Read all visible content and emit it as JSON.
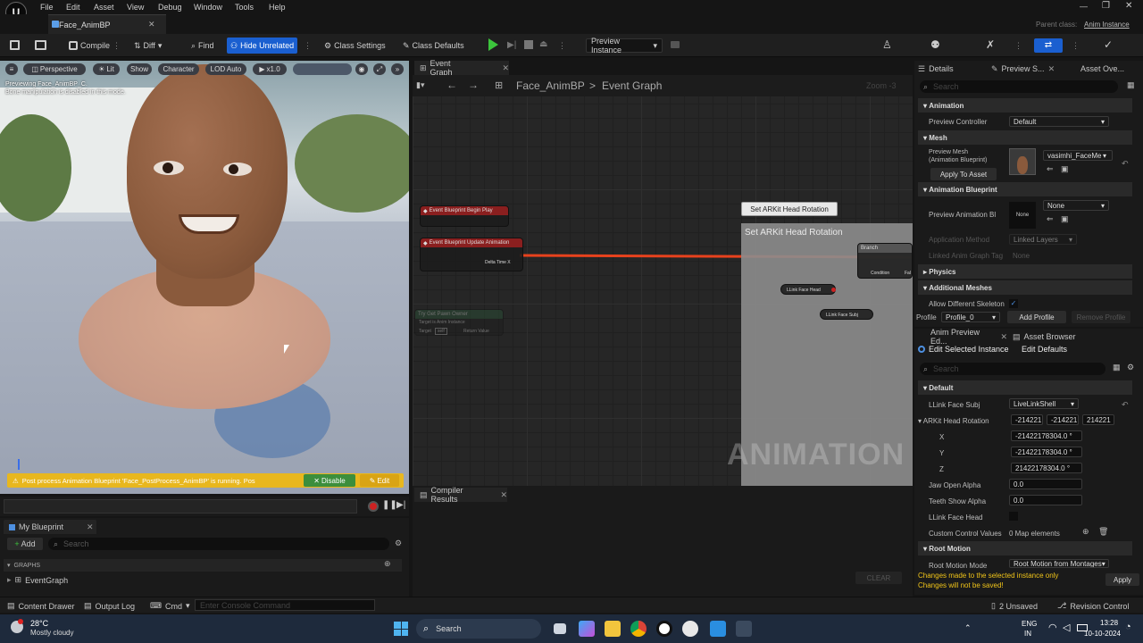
{
  "menu": {
    "items": [
      "File",
      "Edit",
      "Asset",
      "View",
      "Debug",
      "Window",
      "Tools",
      "Help"
    ]
  },
  "window": {
    "tab_title": "Face_AnimBP",
    "parent_class_label": "Parent class:",
    "parent_class_value": "Anim Instance"
  },
  "toolbar": {
    "compile": "Compile",
    "diff": "Diff",
    "find": "Find",
    "hide_unrelated": "Hide Unrelated",
    "class_settings": "Class Settings",
    "class_defaults": "Class Defaults",
    "preview_instance": "Preview Instance"
  },
  "viewport": {
    "perspective": "Perspective",
    "lit": "Lit",
    "show": "Show",
    "character": "Character",
    "lod": "LOD Auto",
    "speed": "x1.0",
    "overlay_line1": "Previewing Face_AnimBP_C.",
    "overlay_line2": "Bone manipulation is disabled in this mode.",
    "notice": "Post process Animation Blueprint 'Face_PostProcess_AnimBP' is running. Pos",
    "disable": "Disable",
    "edit": "Edit"
  },
  "graph": {
    "tab": "Event Graph",
    "breadcrumb_root": "Face_AnimBP",
    "breadcrumb_sep": ">",
    "breadcrumb_leaf": "Event Graph",
    "zoom": "Zoom -3",
    "node_begin_play": "Event Blueprint Begin Play",
    "node_update_anim": "Event Blueprint Update Animation",
    "pin_delta": "Delta Time X",
    "node_comment": "Set ARKit Head Rotation",
    "group_title": "Set ARKit Head Rotation",
    "node_branch": "Branch",
    "pin_condition": "Condition",
    "pin_false": "Fal",
    "node_face_head": "LLink Face Head",
    "node_face_subj": "LLink Face Subj",
    "node_faded_title": "Try Get Pawn Owner",
    "node_faded_sub": "Target is Anim Instance",
    "node_faded_target": "Target",
    "node_faded_self": "self",
    "node_faded_return": "Return Value",
    "watermark": "ANIMATION"
  },
  "compiler": {
    "tab": "Compiler Results",
    "clear": "CLEAR"
  },
  "my_blueprint": {
    "tab": "My Blueprint",
    "add": "Add",
    "search_placeholder": "Search",
    "graphs": "GRAPHS",
    "event_graph": "EventGraph"
  },
  "details": {
    "tab_details": "Details",
    "tab_preview": "Preview S...",
    "tab_asset": "Asset Ove...",
    "search_placeholder": "Search",
    "sec_animation": "Animation",
    "preview_controller": "Preview Controller",
    "preview_controller_val": "Default",
    "sec_mesh": "Mesh",
    "preview_mesh": "Preview Mesh",
    "preview_mesh_sub": "(Animation Blueprint)",
    "mesh_val": "vasimhi_FaceMe",
    "apply_to_asset": "Apply To Asset",
    "sec_anim_bp": "Animation Blueprint",
    "preview_anim_bp": "Preview Animation Bl",
    "none": "None",
    "none2": "None",
    "app_method": "Application Method",
    "app_method_val": "Linked Layers",
    "linked_tag": "Linked Anim Graph Tag",
    "linked_tag_val": "None",
    "sec_physics": "Physics",
    "sec_additional": "Additional Meshes",
    "allow_diff": "Allow Different Skeleton",
    "profile": "Profile",
    "profile_val": "Profile_0",
    "add_profile": "Add Profile",
    "remove_profile": "Remove Profile"
  },
  "anim_preview": {
    "tab": "Anim Preview Ed...",
    "tab_browser": "Asset Browser",
    "edit_selected": "Edit Selected Instance",
    "edit_defaults": "Edit Defaults",
    "search_placeholder": "Search",
    "sec_default": "Default",
    "face_subj": "LLink Face Subj",
    "face_subj_val": "LiveLinkShell",
    "arkit_rot": "ARKit Head Rotation",
    "rot_v1": "-214221",
    "rot_v2": "-214221",
    "rot_v3": "214221",
    "x": "X",
    "x_val": "-21422178304.0 °",
    "y": "Y",
    "y_val": "-21422178304.0 °",
    "z": "Z",
    "z_val": "21422178304.0 °",
    "jaw": "Jaw Open Alpha",
    "jaw_val": "0.0",
    "teeth": "Teeth Show Alpha",
    "teeth_val": "0.0",
    "face_head": "LLink Face Head",
    "custom": "Custom Control Values",
    "custom_val": "0 Map elements",
    "sec_root": "Root Motion",
    "root_mode": "Root Motion Mode",
    "root_mode_val": "Root Motion from Montages",
    "warn1": "Changes made to the selected instance only",
    "warn2": "Changes will not be saved!",
    "apply": "Apply"
  },
  "statusbar": {
    "content_drawer": "Content Drawer",
    "output_log": "Output Log",
    "cmd": "Cmd",
    "console_placeholder": "Enter Console Command",
    "unsaved": "2 Unsaved",
    "revision": "Revision Control"
  },
  "taskbar": {
    "temp": "28°C",
    "weather": "Mostly cloudy",
    "search": "Search",
    "lang1": "ENG",
    "lang2": "IN",
    "time": "13:28",
    "date": "10-10-2024"
  },
  "colors": {
    "accent": "#1a5fd0",
    "exec_wire": "#e8421d",
    "notice": "#e8b71e",
    "warning_text": "#f0c419"
  }
}
